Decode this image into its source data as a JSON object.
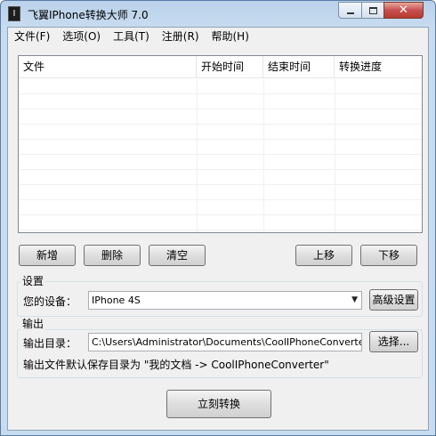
{
  "window": {
    "title": "飞翼IPhone转换大师 7.0",
    "icon_glyph": "I",
    "controls": {
      "minimize_icon": "minimize-icon",
      "maximize_icon": "maximize-icon",
      "close_icon": "close-icon",
      "close_glyph": "✕"
    }
  },
  "menu": [
    {
      "label": "文件(F)"
    },
    {
      "label": "选项(O)"
    },
    {
      "label": "工具(T)"
    },
    {
      "label": "注册(R)"
    },
    {
      "label": "帮助(H)"
    }
  ],
  "file_list": {
    "columns": [
      {
        "label": "文件"
      },
      {
        "label": "开始时间"
      },
      {
        "label": "结束时间"
      },
      {
        "label": "转换进度"
      }
    ],
    "rows": []
  },
  "list_buttons": {
    "add": "新增",
    "delete": "删除",
    "clear": "清空",
    "move_up": "上移",
    "move_down": "下移"
  },
  "settings": {
    "group_label": "设置",
    "device_label": "您的设备：",
    "device_value": "IPhone 4S",
    "dropdown_arrow": "▼",
    "advanced_button": "高级设置"
  },
  "output": {
    "group_label": "输出",
    "dir_label": "输出目录：",
    "dir_value": "C:\\Users\\Administrator\\Documents\\CoolIPhoneConverter\\",
    "browse_button": "选择...",
    "note": "输出文件默认保存目录为 \"我的文档 -> CoolIPhoneConverter\""
  },
  "actions": {
    "convert_button": "立刻转换"
  }
}
